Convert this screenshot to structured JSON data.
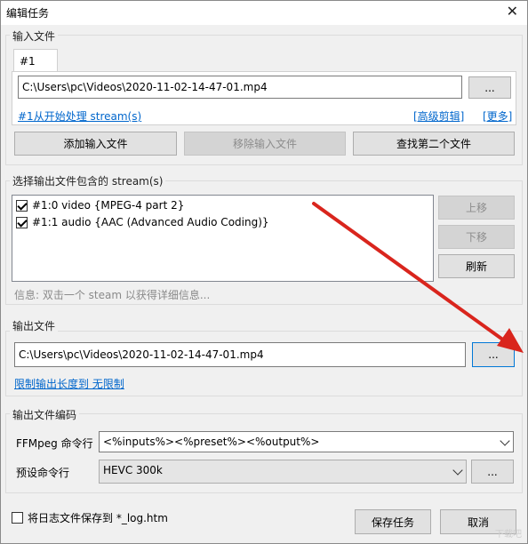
{
  "window": {
    "title": "编辑任务",
    "close_glyph": "✕"
  },
  "input_group": {
    "label": "输入文件",
    "tab_label": "#1",
    "path_value": "C:\\Users\\pc\\Videos\\2020-11-02-14-47-01.mp4",
    "browse_label": "...",
    "process_link": "#1从开始处理 stream(s)",
    "advanced_link": "[高级剪辑]",
    "more_link": "[更多]",
    "add_button": "添加输入文件",
    "remove_button": "移除输入文件",
    "find_button": "查找第二个文件"
  },
  "streams_group": {
    "label": "选择输出文件包含的 stream(s)",
    "items": [
      {
        "label": "#1:0 video {MPEG-4 part 2}",
        "checked": true
      },
      {
        "label": "#1:1 audio {AAC (Advanced Audio Coding)}",
        "checked": true
      }
    ],
    "move_up": "上移",
    "move_down": "下移",
    "refresh": "刷新",
    "info_text": "信息: 双击一个 steam 以获得详细信息..."
  },
  "output_group": {
    "label": "输出文件",
    "path_value": "C:\\Users\\pc\\Videos\\2020-11-02-14-47-01.mp4",
    "browse_label": "...",
    "limit_link": "限制输出长度到 无限制"
  },
  "encode_group": {
    "label": "输出文件编码",
    "ffmpeg_label": "FFMpeg 命令行",
    "ffmpeg_value": "<%inputs%><%preset%><%output%>",
    "preset_label": "预设命令行",
    "preset_value": "HEVC 300k",
    "preset_browse": "..."
  },
  "footer": {
    "log_checkbox_label": "将日志文件保存到 *_log.htm",
    "log_checked": false,
    "save_button": "保存任务",
    "cancel_button": "取消"
  },
  "colors": {
    "arrow": "#d9251d",
    "link": "#0066cc",
    "focus": "#0078d7"
  },
  "watermark": "下载吧"
}
